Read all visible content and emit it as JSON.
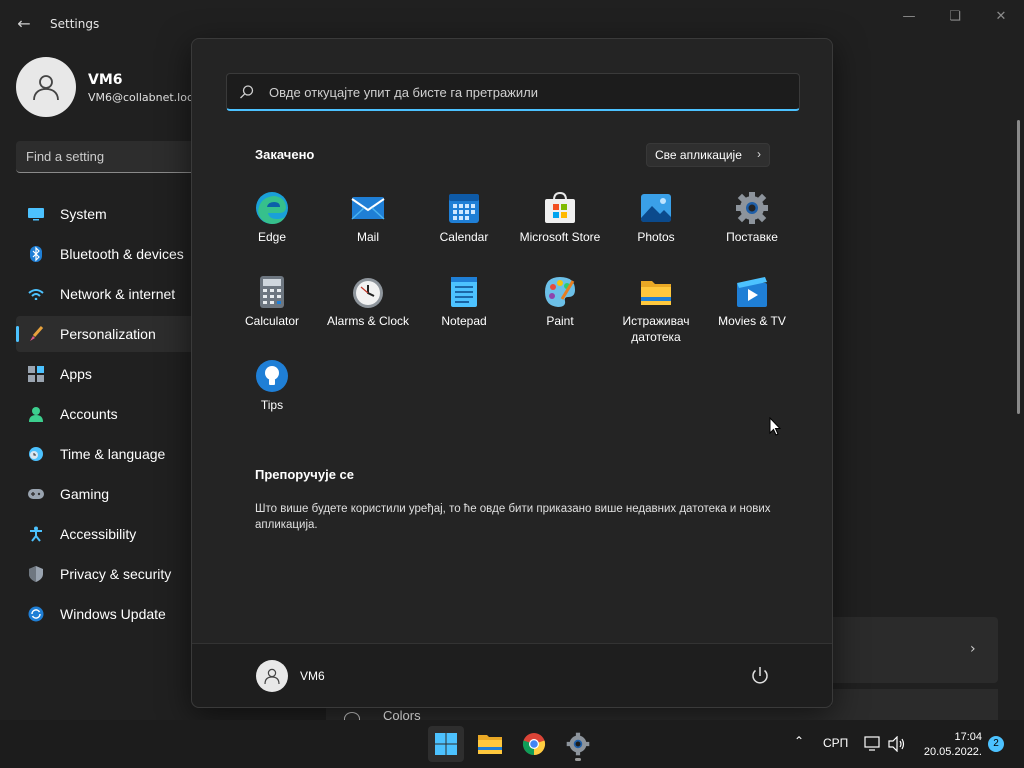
{
  "window": {
    "title": "Settings",
    "back_icon": "back-arrow-icon",
    "controls": [
      "minimize",
      "maximize",
      "close"
    ]
  },
  "profile": {
    "name": "VM6",
    "email": "VM6@collabnet.loc"
  },
  "search": {
    "placeholder": "Find a setting"
  },
  "sidebar": {
    "items": [
      {
        "label": "System",
        "icon": "monitor-icon"
      },
      {
        "label": "Bluetooth & devices",
        "icon": "bluetooth-icon"
      },
      {
        "label": "Network & internet",
        "icon": "wifi-icon"
      },
      {
        "label": "Personalization",
        "icon": "brush-icon",
        "active": true
      },
      {
        "label": "Apps",
        "icon": "apps-icon"
      },
      {
        "label": "Accounts",
        "icon": "person-icon"
      },
      {
        "label": "Time & language",
        "icon": "clock-globe-icon"
      },
      {
        "label": "Gaming",
        "icon": "gamepad-icon"
      },
      {
        "label": "Accessibility",
        "icon": "accessibility-icon"
      },
      {
        "label": "Privacy & security",
        "icon": "shield-icon"
      },
      {
        "label": "Windows Update",
        "icon": "update-icon"
      }
    ]
  },
  "main": {
    "colors_label": "Colors"
  },
  "start_menu": {
    "search_placeholder": "Овде откуцајте упит да бисте га претражили",
    "pinned_title": "Закачено",
    "all_apps_label": "Све апликације",
    "pinned_apps": [
      {
        "label": "Edge",
        "icon": "edge-icon"
      },
      {
        "label": "Mail",
        "icon": "mail-icon"
      },
      {
        "label": "Calendar",
        "icon": "calendar-icon"
      },
      {
        "label": "Microsoft Store",
        "icon": "store-icon"
      },
      {
        "label": "Photos",
        "icon": "photos-icon"
      },
      {
        "label": "Поставке",
        "icon": "settings-gear-icon"
      },
      {
        "label": "Calculator",
        "icon": "calculator-icon"
      },
      {
        "label": "Alarms & Clock",
        "icon": "alarm-clock-icon"
      },
      {
        "label": "Notepad",
        "icon": "notepad-icon"
      },
      {
        "label": "Paint",
        "icon": "paint-icon"
      },
      {
        "label": "Истраживач датотека",
        "icon": "folder-icon"
      },
      {
        "label": "Movies & TV",
        "icon": "movies-icon"
      },
      {
        "label": "Tips",
        "icon": "tips-bulb-icon"
      }
    ],
    "recommended_title": "Препоручује се",
    "recommended_text": "Што више будете користили уређај, то ће овде бити приказано више недавних датотека и нових апликација.",
    "user_name": "VM6"
  },
  "taskbar": {
    "apps": [
      {
        "name": "start",
        "icon": "windows-logo-icon"
      },
      {
        "name": "file-explorer",
        "icon": "folder-icon"
      },
      {
        "name": "chrome",
        "icon": "chrome-icon"
      },
      {
        "name": "settings",
        "icon": "settings-gear-icon"
      }
    ],
    "language": "СРП",
    "time": "17:04",
    "date": "20.05.2022.",
    "notification_count": "2"
  },
  "colors": {
    "accent": "#4cc2ff",
    "background": "#202020",
    "start_menu_bg": "#242424"
  }
}
